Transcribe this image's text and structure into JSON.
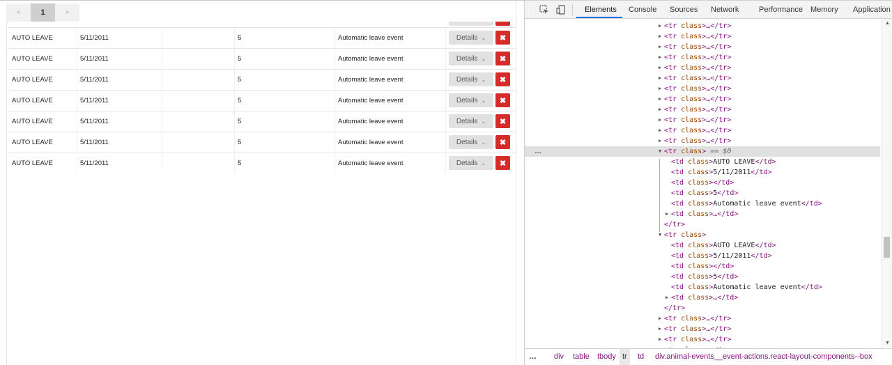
{
  "pager": {
    "prev": "<",
    "current": "1",
    "next": ">"
  },
  "table": {
    "rows": [
      {
        "type": "AUTO LEAVE",
        "date": "5/11/2011",
        "blank": "",
        "count": "5",
        "description": "Automatic leave event",
        "details": "Details"
      },
      {
        "type": "AUTO LEAVE",
        "date": "5/11/2011",
        "blank": "",
        "count": "5",
        "description": "Automatic leave event",
        "details": "Details"
      },
      {
        "type": "AUTO LEAVE",
        "date": "5/11/2011",
        "blank": "",
        "count": "5",
        "description": "Automatic leave event",
        "details": "Details"
      },
      {
        "type": "AUTO LEAVE",
        "date": "5/11/2011",
        "blank": "",
        "count": "5",
        "description": "Automatic leave event",
        "details": "Details"
      },
      {
        "type": "AUTO LEAVE",
        "date": "5/11/2011",
        "blank": "",
        "count": "5",
        "description": "Automatic leave event",
        "details": "Details"
      },
      {
        "type": "AUTO LEAVE",
        "date": "5/11/2011",
        "blank": "",
        "count": "5",
        "description": "Automatic leave event",
        "details": "Details"
      },
      {
        "type": "AUTO LEAVE",
        "date": "5/11/2011",
        "blank": "",
        "count": "5",
        "description": "Automatic leave event",
        "details": "Details"
      }
    ],
    "chevron": "⌄",
    "delete_glyph": "✖"
  },
  "devtools": {
    "tabs": [
      "Elements",
      "Console",
      "Sources",
      "Network",
      "Performance",
      "Memory",
      "Application"
    ],
    "active_tab": "Elements",
    "dom": {
      "tr_open": "<tr",
      "class_attr": "class",
      "collapsed_tail": ">…</tr>",
      "selected_marker": "== $0",
      "td_open": "<td",
      "td_close": "</td>",
      "tr_close": "</tr>",
      "ellipsis_cell": ">…</td>",
      "cells": [
        "AUTO LEAVE",
        "5/11/2011",
        "",
        "5",
        "Automatic leave event"
      ],
      "row_dots": "…"
    },
    "breadcrumbs": [
      "div",
      "table",
      "tbody",
      "tr",
      "td",
      "div.animal-events__event-actions.react-layout-components--box"
    ],
    "breadcrumb_more": "…",
    "scroll_up": "▲",
    "scroll_down": "▼"
  }
}
